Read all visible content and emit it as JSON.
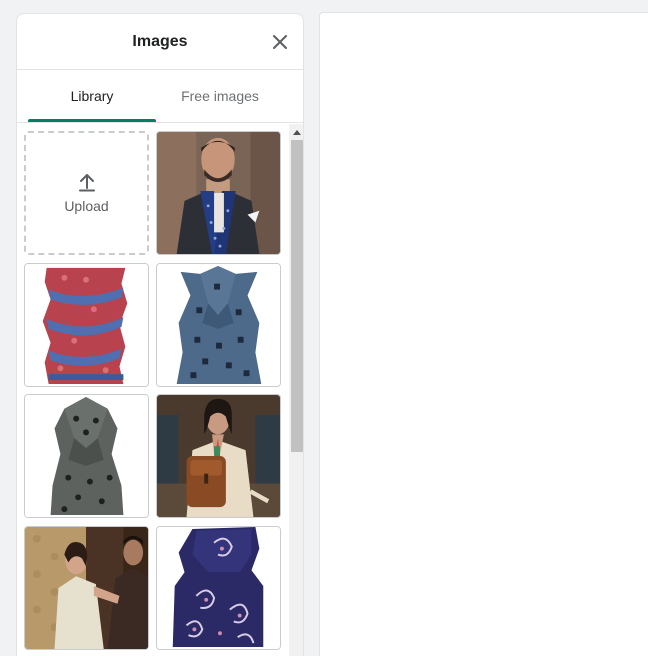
{
  "panel": {
    "title": "Images",
    "tabs": [
      {
        "label": "Library",
        "active": true
      },
      {
        "label": "Free images",
        "active": false
      }
    ]
  },
  "upload": {
    "label": "Upload",
    "icon": "upload-arrow-icon"
  },
  "images": [
    {
      "name": "image-man-navy-scarf"
    },
    {
      "name": "image-red-blue-paisley-scarf"
    },
    {
      "name": "image-blue-patterned-tie"
    },
    {
      "name": "image-grey-patterned-tie"
    },
    {
      "name": "image-woman-leather-backpack"
    },
    {
      "name": "image-couple-vintage"
    },
    {
      "name": "image-navy-paisley-tie"
    }
  ],
  "colors": {
    "accent": "#008060",
    "border": "#c9cccf",
    "text": "#202223",
    "muted": "#6d7175"
  }
}
